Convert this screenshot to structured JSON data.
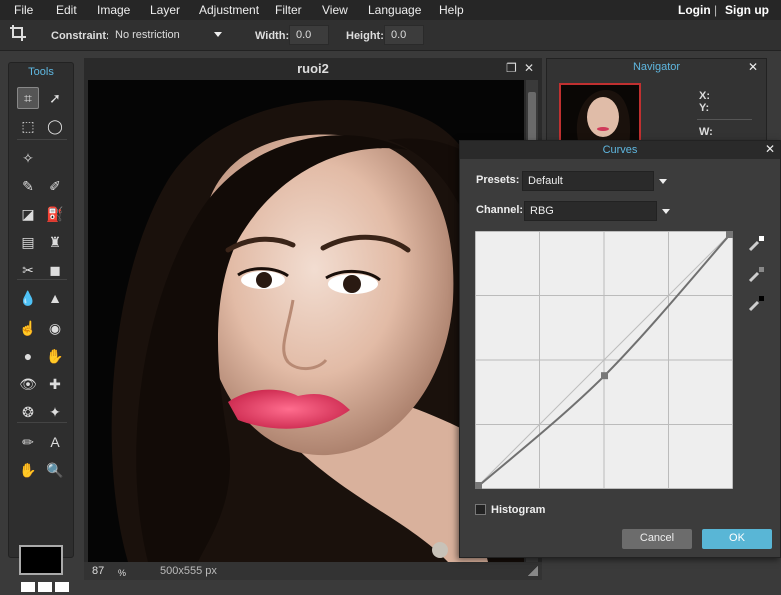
{
  "menu": {
    "items": [
      "File",
      "Edit",
      "Image",
      "Layer",
      "Adjustment",
      "Filter",
      "View",
      "Language",
      "Help"
    ],
    "login": "Login",
    "separator": "|",
    "signup": "Sign up"
  },
  "options_bar": {
    "constraint_label": "Constraint:",
    "constraint_value": "No restriction",
    "width_label": "Width:",
    "width_value": "0.0",
    "height_label": "Height:",
    "height_value": "0.0"
  },
  "tools": {
    "title": "Tools",
    "items": [
      {
        "name": "crop-icon",
        "glyph": "⌗",
        "active": true
      },
      {
        "name": "move-icon",
        "glyph": "➚"
      },
      {
        "name": "marquee-icon",
        "glyph": "⬚"
      },
      {
        "name": "lasso-icon",
        "glyph": "◯"
      },
      {
        "name": "magic-wand-icon",
        "glyph": "✧"
      },
      {
        "name": "pencil-icon",
        "glyph": "✎"
      },
      {
        "name": "brush-icon",
        "glyph": "✐"
      },
      {
        "name": "eraser-icon",
        "glyph": "◪"
      },
      {
        "name": "paint-bucket-icon",
        "glyph": "⛽"
      },
      {
        "name": "gradient-icon",
        "glyph": "▤"
      },
      {
        "name": "clone-stamp-icon",
        "glyph": "♜"
      },
      {
        "name": "color-replace-icon",
        "glyph": "✂"
      },
      {
        "name": "drawing-icon",
        "glyph": "◼"
      },
      {
        "name": "blur-icon",
        "glyph": "💧"
      },
      {
        "name": "sharpen-icon",
        "glyph": "▲"
      },
      {
        "name": "smudge-icon",
        "glyph": "☝"
      },
      {
        "name": "sponge-icon",
        "glyph": "◉"
      },
      {
        "name": "dodge-icon",
        "glyph": "●"
      },
      {
        "name": "burn-icon",
        "glyph": "✋"
      },
      {
        "name": "red-eye-icon",
        "glyph": "👁"
      },
      {
        "name": "spot-heal-icon",
        "glyph": "✚"
      },
      {
        "name": "bloat-icon",
        "glyph": "❂"
      },
      {
        "name": "pinch-icon",
        "glyph": "✦"
      },
      {
        "name": "color-picker-icon",
        "glyph": "✏"
      },
      {
        "name": "type-icon",
        "glyph": "A"
      },
      {
        "name": "hand-icon",
        "glyph": "✋"
      },
      {
        "name": "zoom-icon",
        "glyph": "🔍"
      }
    ]
  },
  "document": {
    "title": "ruoi2",
    "zoom": "87",
    "zoom_unit": "%",
    "dimensions": "500x555 px"
  },
  "navigator": {
    "title": "Navigator",
    "x_label": "X:",
    "y_label": "Y:",
    "w_label": "W:"
  },
  "curves": {
    "title": "Curves",
    "presets_label": "Presets:",
    "presets_value": "Default",
    "channel_label": "Channel:",
    "channel_value": "RBG",
    "histogram_label": "Histogram",
    "cancel_label": "Cancel",
    "ok_label": "OK",
    "points": [
      [
        0,
        0
      ],
      [
        128,
        112
      ],
      [
        255,
        255
      ]
    ]
  },
  "colors": {
    "accent": "#5fb7e0",
    "ok_button": "#59b6d6",
    "panel": "#3c3c3c",
    "menubar": "#262626"
  }
}
